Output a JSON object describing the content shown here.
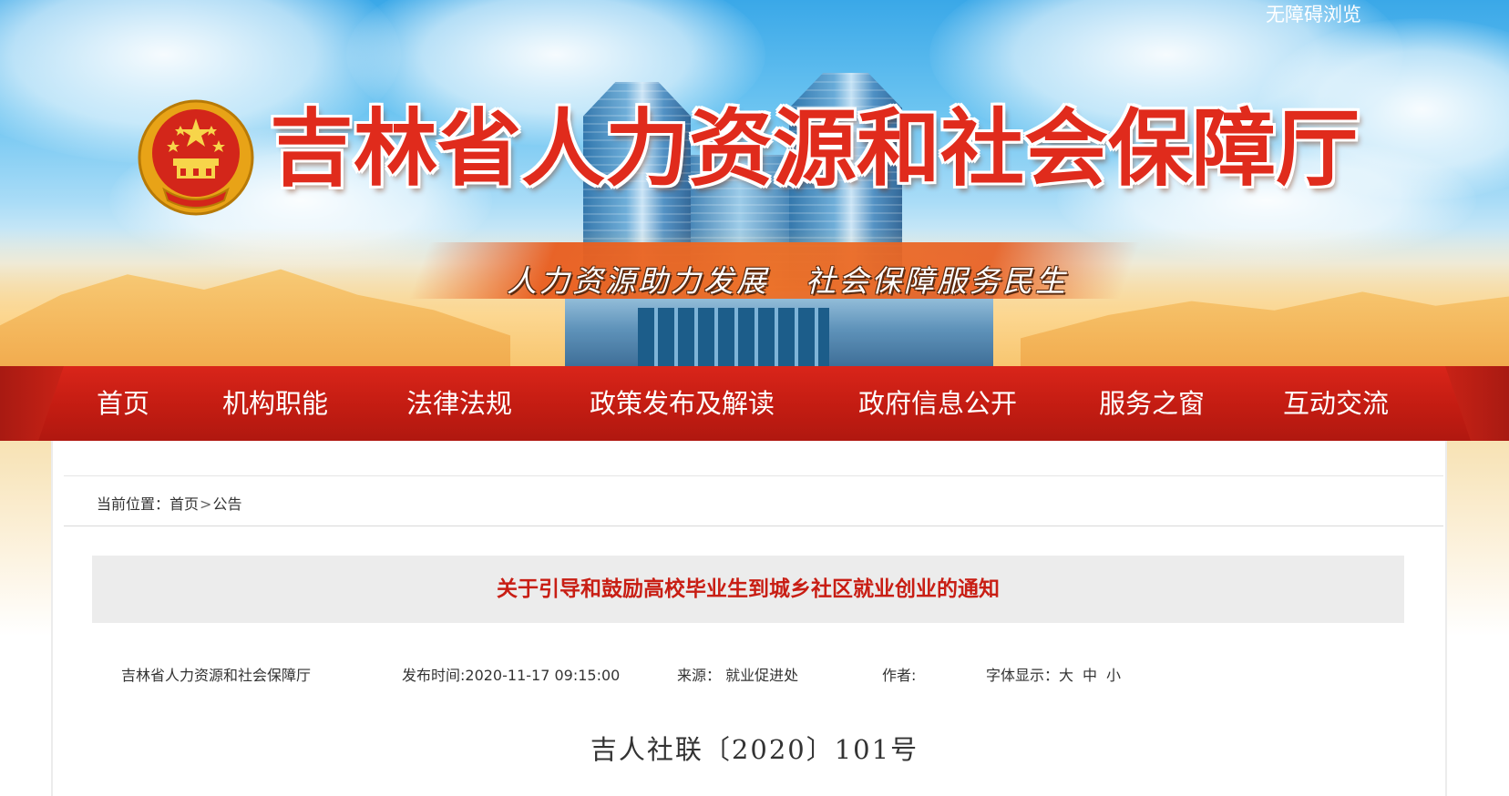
{
  "header": {
    "site_title": "吉林省人力资源和社会保障厅",
    "slogan_left": "人力资源助力发展",
    "slogan_right": "社会保障服务民生",
    "accessible_link": "无障碍浏览"
  },
  "nav": {
    "items": [
      {
        "label": "首页"
      },
      {
        "label": "机构职能"
      },
      {
        "label": "法律法规"
      },
      {
        "label": "政策发布及解读"
      },
      {
        "label": "政府信息公开"
      },
      {
        "label": "服务之窗"
      },
      {
        "label": "互动交流"
      }
    ]
  },
  "breadcrumb": {
    "prefix": "当前位置：",
    "home": "首页",
    "separator": ">",
    "current": "公告"
  },
  "article": {
    "title": "关于引导和鼓励高校毕业生到城乡社区就业创业的通知",
    "publisher": "吉林省人力资源和社会保障厅",
    "publish_time": "发布时间:2020-11-17 09:15:00",
    "source_label": "来源：",
    "source_value": "就业促进处",
    "author_label": "作者:",
    "font_size_label": "字体显示：",
    "font_size_options": [
      "大",
      "中",
      "小"
    ],
    "doc_number": "吉人社联〔2020〕101号"
  },
  "colors": {
    "nav_red": "#c81e14",
    "title_red": "#c81e14",
    "site_title_red": "#e02b1c"
  },
  "icons": {
    "emblem": "national-emblem-icon"
  }
}
